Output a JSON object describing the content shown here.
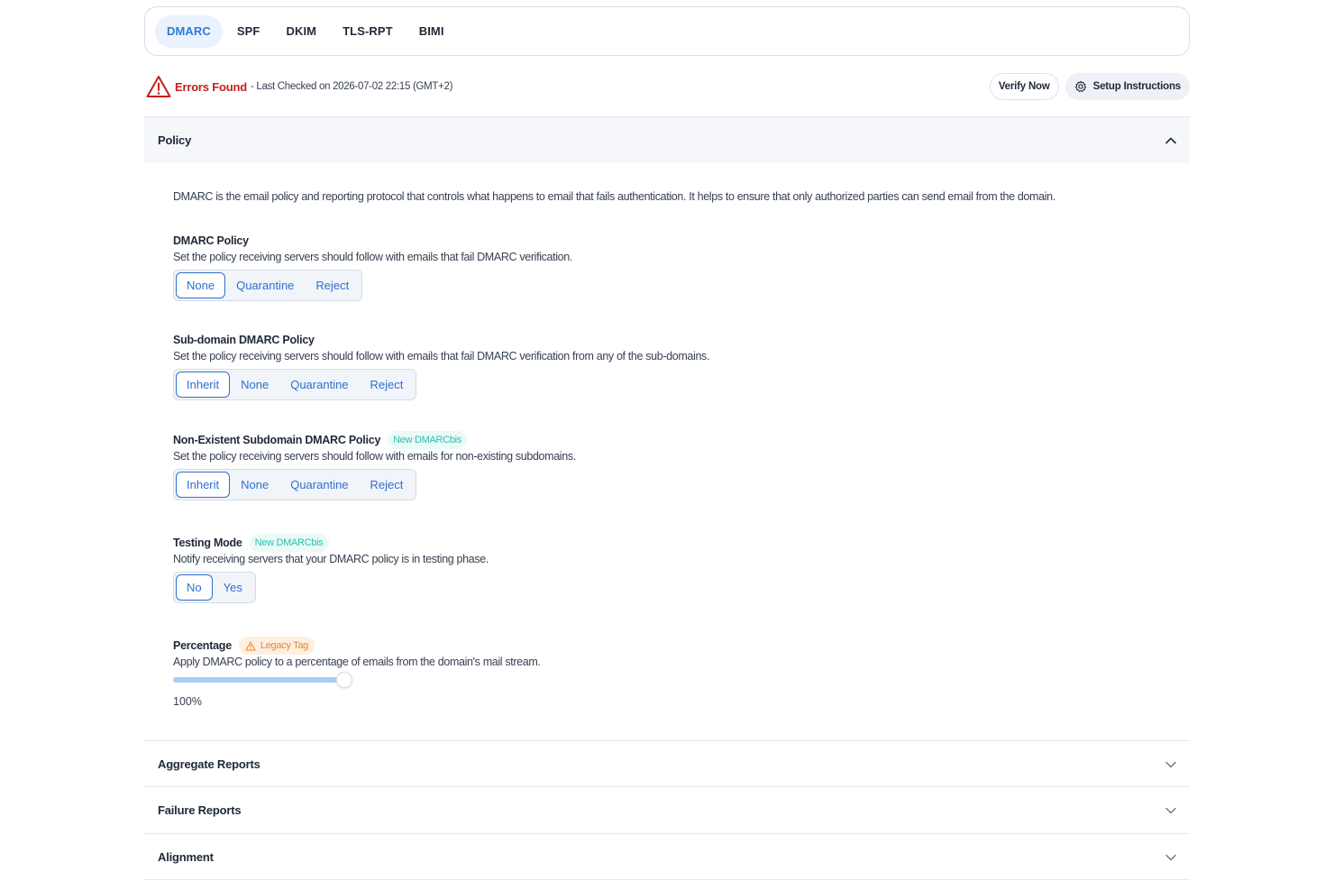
{
  "tabs": [
    {
      "label": "DMARC",
      "active": true
    },
    {
      "label": "SPF",
      "active": false
    },
    {
      "label": "DKIM",
      "active": false
    },
    {
      "label": "TLS-RPT",
      "active": false
    },
    {
      "label": "BIMI",
      "active": false
    }
  ],
  "status": {
    "title": "Errors Found",
    "subtitle": "- Last Checked on 2026-07-02 22:15 (GMT+2)",
    "icon": "warning-triangle-icon",
    "color": "#c4201f"
  },
  "actions": {
    "verify_label": "Verify Now",
    "setup_label": "Setup Instructions"
  },
  "sections": {
    "policy": {
      "label": "Policy",
      "expanded": true
    },
    "aggregate": {
      "label": "Aggregate Reports",
      "expanded": false
    },
    "failure": {
      "label": "Failure Reports",
      "expanded": false
    },
    "alignment": {
      "label": "Alignment",
      "expanded": false
    }
  },
  "policy": {
    "intro": "DMARC is the email policy and reporting protocol that controls what happens to email that fails authentication. It helps to ensure that only authorized parties can send email from the domain.",
    "dmarc_policy": {
      "title": "DMARC Policy",
      "desc": "Set the policy receiving servers should follow with emails that fail DMARC verification.",
      "options": [
        "None",
        "Quarantine",
        "Reject"
      ],
      "selected": "None"
    },
    "subdomain_policy": {
      "title": "Sub-domain DMARC Policy",
      "desc": "Set the policy receiving servers should follow with emails that fail DMARC verification from any of the sub-domains.",
      "options": [
        "Inherit",
        "None",
        "Quarantine",
        "Reject"
      ],
      "selected": "Inherit"
    },
    "nonexistent_policy": {
      "title": "Non-Existent Subdomain DMARC Policy",
      "badge": "New DMARCbis",
      "desc": "Set the policy receiving servers should follow with emails for non-existing subdomains.",
      "options": [
        "Inherit",
        "None",
        "Quarantine",
        "Reject"
      ],
      "selected": "Inherit"
    },
    "testing_mode": {
      "title": "Testing Mode",
      "badge": "New DMARCbis",
      "desc": "Notify receiving servers that your DMARC policy is in testing phase.",
      "options": [
        "No",
        "Yes"
      ],
      "selected": "No"
    },
    "percentage": {
      "title": "Percentage",
      "badge": "Legacy Tag",
      "desc": "Apply DMARC policy to a percentage of emails from the domain's mail stream.",
      "value": 100,
      "value_label": "100%"
    }
  },
  "colors": {
    "accent": "#2e6fd1",
    "tab_active": "#2e7bd8",
    "error": "#c4201f",
    "badge_new": "#2bbfae",
    "badge_legacy": "#e58a26"
  }
}
